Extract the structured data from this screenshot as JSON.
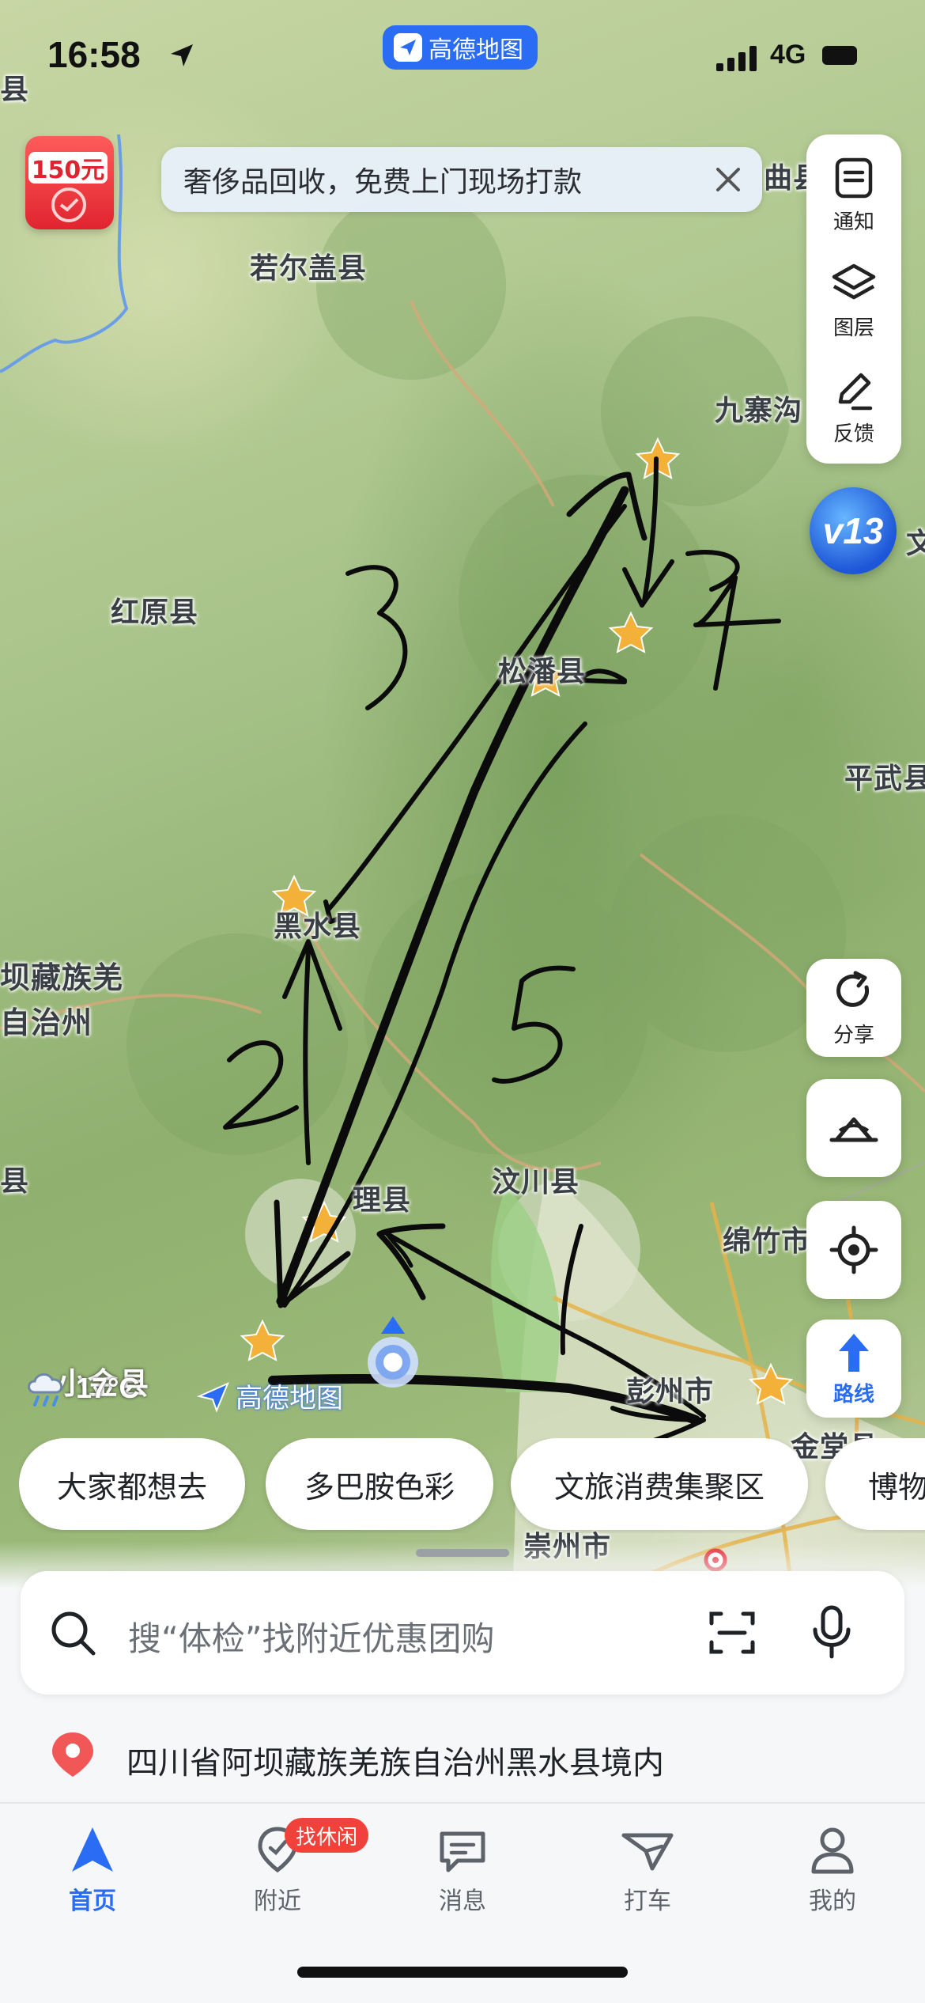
{
  "status_bar": {
    "time": "16:58",
    "carrier_app": "高德地图",
    "network": "4G"
  },
  "coupon": {
    "amount": "150元"
  },
  "ad_banner": {
    "text": "奢侈品回收，免费上门现场打款"
  },
  "right_toolbar": [
    {
      "label": "通知",
      "icon": "notification-icon"
    },
    {
      "label": "图层",
      "icon": "layers-icon"
    },
    {
      "label": "反馈",
      "icon": "feedback-pencil-icon"
    }
  ],
  "version_badge": "v13",
  "map_labels": [
    {
      "text": "若尔盖县"
    },
    {
      "text": "九寨沟"
    },
    {
      "text": "红原县"
    },
    {
      "text": "松潘县"
    },
    {
      "text": "平武县"
    },
    {
      "text": "黑水县"
    },
    {
      "text": "坝藏族羌"
    },
    {
      "text": "自治州"
    },
    {
      "text": "理县"
    },
    {
      "text": "汶川县"
    },
    {
      "text": "绵竹市"
    },
    {
      "text": "彭州市"
    },
    {
      "text": "金堂县"
    },
    {
      "text": "崇州市"
    },
    {
      "text": "曲县"
    },
    {
      "text": "县"
    },
    {
      "text": "县"
    },
    {
      "text": "文"
    },
    {
      "text": "小金县"
    }
  ],
  "handwritten_marks": [
    "1",
    "2",
    "3",
    "4",
    "5"
  ],
  "float_buttons": {
    "share": "分享",
    "route": "路线"
  },
  "weather": {
    "temp": "17°C"
  },
  "watermark": "高德地图",
  "chips": [
    "大家都想去",
    "多巴胺色彩",
    "文旅消费集聚区",
    "博物馆"
  ],
  "search": {
    "placeholder": "搜“体检”找附近优惠团购"
  },
  "location": {
    "text": "四川省阿坝藏族羌族自治州黑水县境内"
  },
  "tabbar": {
    "items": [
      {
        "label": "首页",
        "icon": "home-arrow-icon",
        "active": true
      },
      {
        "label": "附近",
        "icon": "nearby-pin-icon",
        "badge": "找休闲"
      },
      {
        "label": "消息",
        "icon": "message-icon"
      },
      {
        "label": "打车",
        "icon": "taxi-icon"
      },
      {
        "label": "我的",
        "icon": "profile-icon"
      }
    ]
  },
  "colors": {
    "accent": "#2a6cf3",
    "badge_red": "#f0423b",
    "coupon_red": "#e0242f"
  }
}
